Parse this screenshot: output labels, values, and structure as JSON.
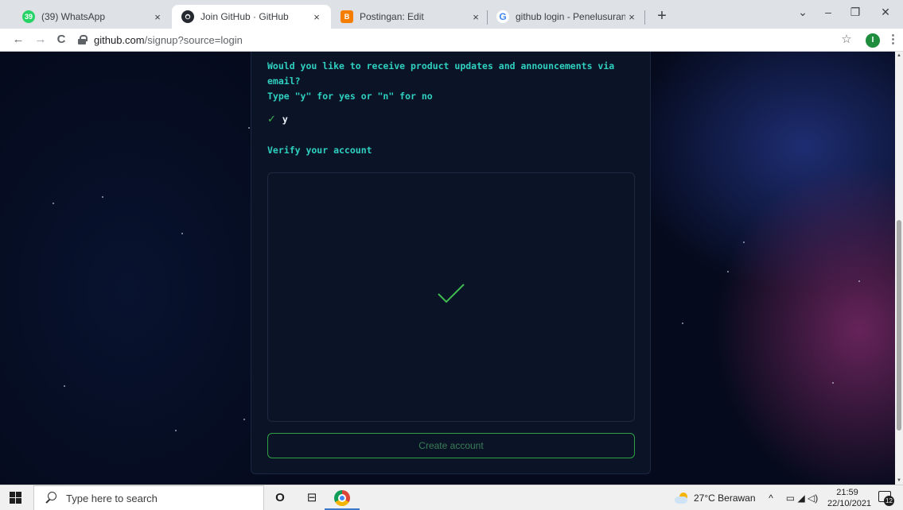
{
  "browser": {
    "tabs": [
      {
        "title": "(39) WhatsApp",
        "favicon_text": "39",
        "favicon_color": "#25d366",
        "active": false
      },
      {
        "title": "Join GitHub · GitHub",
        "favicon_text": "",
        "favicon_color": "#24292f",
        "active": true
      },
      {
        "title": "Postingan: Edit",
        "favicon_text": "B",
        "favicon_color": "#f57d00",
        "active": false
      },
      {
        "title": "github login - Penelusuran Goog",
        "favicon_text": "G",
        "favicon_color": "#4285f4",
        "active": false
      }
    ],
    "close_glyph": "×",
    "new_tab_glyph": "+",
    "window_controls": {
      "dropdown": "⌄",
      "minimize": "–",
      "maximize": "❐",
      "close": "✕"
    },
    "nav": {
      "back": "←",
      "forward": "→",
      "reload": "C"
    },
    "url": {
      "host": "github.com",
      "path": "/signup?source=login"
    },
    "bookmark_star": "☆",
    "profile_initial": "I",
    "menu_glyph": "⋮"
  },
  "signup": {
    "prompt_line_1": "Would you like to receive product updates and announcements via",
    "prompt_line_2": "email?",
    "prompt_line_3": "Type \"y\" for yes or \"n\" for no",
    "answer_check": "✓",
    "answer_value": "y",
    "verify_title": "Verify your account",
    "verify_status": "verified-checkmark",
    "create_button": "Create account"
  },
  "scrollbar": {
    "up": "▲",
    "down": "▼"
  },
  "taskbar": {
    "search_placeholder": "Type here to search",
    "cortana_glyph": "O",
    "taskview_glyph": "⊟",
    "weather": "27°C  Berawan",
    "tray_chevron": "^",
    "tray_icons": "▭  ◢  ◁)",
    "time": "21:59",
    "date": "22/10/2021",
    "notification_count": "12"
  },
  "colors": {
    "accent_teal": "#2fd0c0",
    "success_green": "#3fb950",
    "card_bg": "#0b1427",
    "page_bg": "#050a1c"
  }
}
